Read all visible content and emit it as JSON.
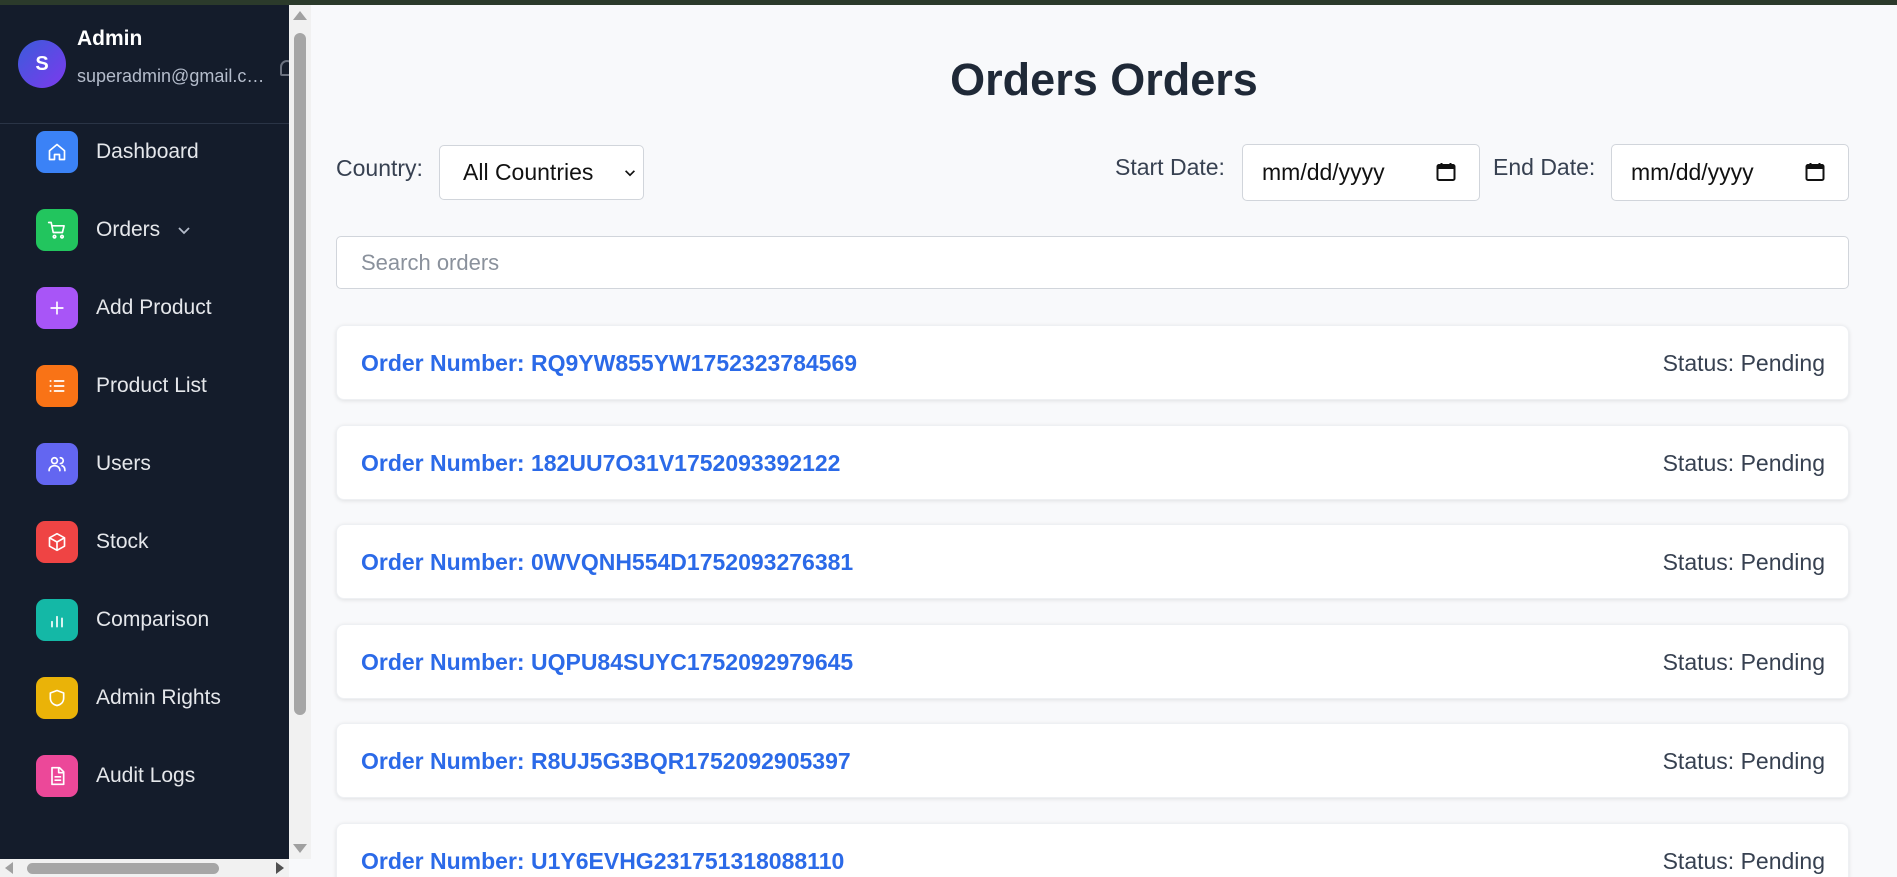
{
  "profile": {
    "avatar_initial": "S",
    "name": "Admin",
    "email": "superadmin@gmail.com"
  },
  "sidebar": {
    "items": [
      {
        "label": "Dashboard",
        "icon": "home-icon",
        "color": "#3b82f6"
      },
      {
        "label": "Orders",
        "icon": "cart-icon",
        "color": "#22c55e"
      },
      {
        "label": "Add Product",
        "icon": "plus-icon",
        "color": "#a855f7"
      },
      {
        "label": "Product List",
        "icon": "list-icon",
        "color": "#f97316"
      },
      {
        "label": "Users",
        "icon": "users-icon",
        "color": "#6366f1"
      },
      {
        "label": "Stock",
        "icon": "box-icon",
        "color": "#ef4444"
      },
      {
        "label": "Comparison",
        "icon": "bar-chart-icon",
        "color": "#14b8a6"
      },
      {
        "label": "Admin Rights",
        "icon": "shield-icon",
        "color": "#eab308"
      },
      {
        "label": "Audit Logs",
        "icon": "document-icon",
        "color": "#ec4899"
      }
    ]
  },
  "main": {
    "title": "Orders Orders",
    "filters": {
      "country_label": "Country:",
      "country_value": "All Countries",
      "start_date_label": "Start Date:",
      "start_date_value": "mm/dd/yyyy",
      "end_date_label": "End Date:",
      "end_date_value": "mm/dd/yyyy"
    },
    "search": {
      "placeholder": "Search orders"
    },
    "orders": [
      {
        "number": "Order Number: RQ9YW855YW1752323784569",
        "status": "Status: Pending"
      },
      {
        "number": "Order Number: 182UU7O31V1752093392122",
        "status": "Status: Pending"
      },
      {
        "number": "Order Number: 0WVQNH554D1752093276381",
        "status": "Status: Pending"
      },
      {
        "number": "Order Number: UQPU84SUYC1752092979645",
        "status": "Status: Pending"
      },
      {
        "number": "Order Number: R8UJ5G3BQR1752092905397",
        "status": "Status: Pending"
      },
      {
        "number": "Order Number: U1Y6EVHG231751318088110",
        "status": "Status: Pending"
      }
    ]
  },
  "colors": {
    "sidebar_bg": "#141c2b",
    "link": "#2b6ae8",
    "page_bg": "#f8f9fb"
  }
}
